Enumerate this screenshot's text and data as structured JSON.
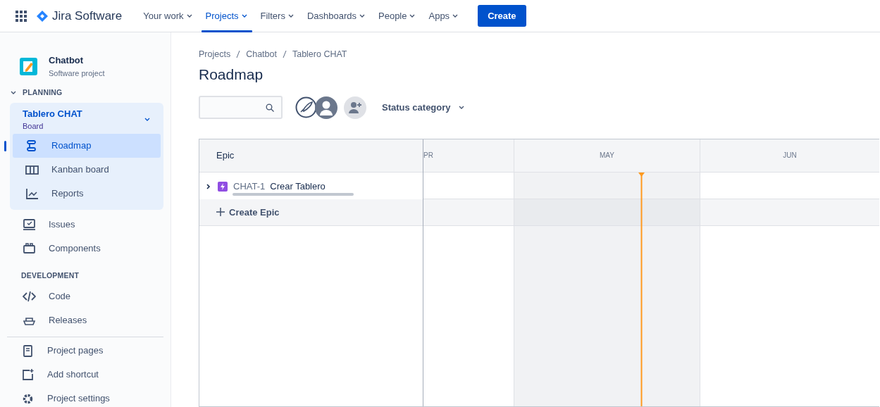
{
  "top_nav": {
    "product": "Jira Software",
    "items": [
      {
        "label": "Your work",
        "selected": false
      },
      {
        "label": "Projects",
        "selected": true
      },
      {
        "label": "Filters",
        "selected": false
      },
      {
        "label": "Dashboards",
        "selected": false
      },
      {
        "label": "People",
        "selected": false
      },
      {
        "label": "Apps",
        "selected": false
      }
    ],
    "create_button": "Create"
  },
  "sidebar": {
    "project": {
      "name": "Chatbot",
      "type": "Software project"
    },
    "planning": {
      "heading": "PLANNING",
      "expanded": true,
      "board": {
        "name": "Tablero CHAT",
        "subtitle": "Board",
        "expanded": true
      },
      "board_items": [
        {
          "label": "Roadmap",
          "selected": true
        },
        {
          "label": "Kanban board",
          "selected": false
        },
        {
          "label": "Reports",
          "selected": false
        }
      ],
      "items": [
        {
          "label": "Issues",
          "selected": false
        },
        {
          "label": "Components",
          "selected": false
        }
      ]
    },
    "development": {
      "heading": "DEVELOPMENT",
      "items": [
        {
          "label": "Code",
          "selected": false
        },
        {
          "label": "Releases",
          "selected": false
        }
      ]
    },
    "footer_items": [
      {
        "label": "Project pages"
      },
      {
        "label": "Add shortcut"
      },
      {
        "label": "Project settings"
      }
    ]
  },
  "breadcrumbs": [
    "Projects",
    "Chatbot",
    "Tablero CHAT"
  ],
  "page_title": "Roadmap",
  "toolbar": {
    "status_filter": "Status category"
  },
  "roadmap": {
    "epic_header": "Epic",
    "months": [
      {
        "label": "PR",
        "current": false
      },
      {
        "label": "MAY",
        "current": true
      },
      {
        "label": "JUN",
        "current": false
      }
    ],
    "epics": [
      {
        "key": "CHAT-1",
        "title": "Crear Tablero",
        "expanded": false,
        "level": 0
      }
    ],
    "create_epic": "Create Epic"
  }
}
